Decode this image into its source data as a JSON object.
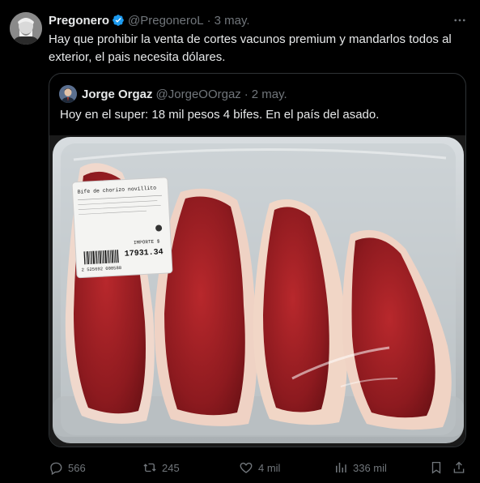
{
  "post": {
    "author_name": "Pregonero",
    "author_handle": "@PregoneroL",
    "time": "3 may.",
    "text": "Hay que prohibir la venta de cortes vacunos premium y mandarlos todos al exterior, el pais necesita dólares."
  },
  "quote": {
    "author_name": "Jorge Orgaz",
    "author_handle": "@JorgeOOrgaz",
    "time": "2 may.",
    "text": "Hoy en el super: 18 mil pesos 4 bifes. En el país del asado.",
    "label": {
      "product": "Bife de chorizo novillito",
      "price": "17931.34",
      "price_label": "IMPORTE $",
      "barcode": "2 525692 008588"
    }
  },
  "actions": {
    "replies": "566",
    "reposts": "245",
    "likes": "4 mil",
    "views": "336 mil"
  },
  "colors": {
    "background": "#000000",
    "text": "#e7e9ea",
    "muted": "#71767b",
    "verified": "#1d9bf0"
  }
}
